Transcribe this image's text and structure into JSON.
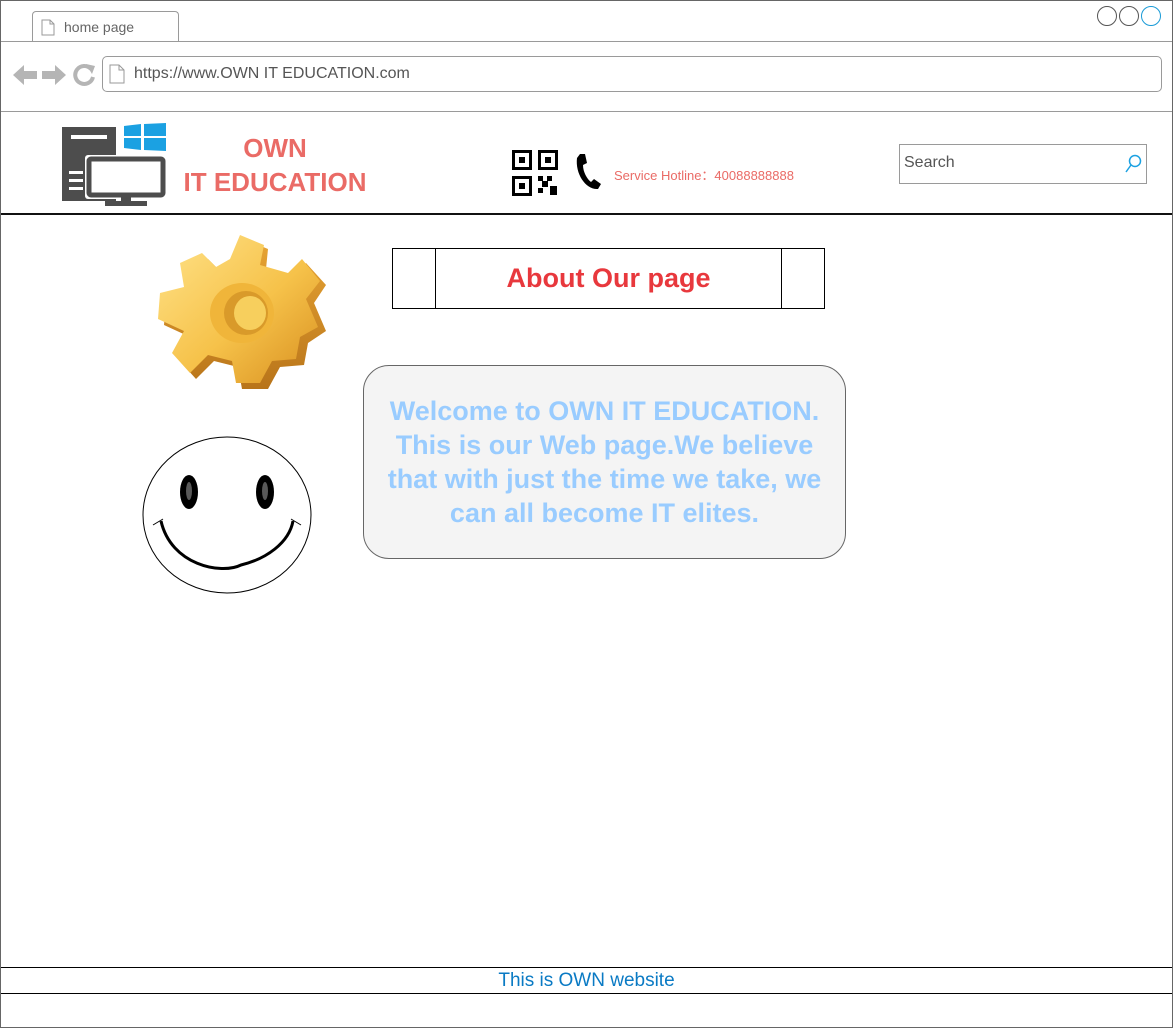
{
  "browser": {
    "tab_title": "home page",
    "url": "https://www.OWN IT EDUCATION.com"
  },
  "header": {
    "brand_line1": "OWN",
    "brand_line2": "IT EDUCATION",
    "hotline": "Service Hotline：40088888888",
    "search_placeholder": "Search"
  },
  "main": {
    "about_title": "About Our page",
    "welcome_text": "Welcome to OWN IT EDUCATION. This is our Web page.We believe that with just the time we take, we can all become IT elites."
  },
  "footer": {
    "text": "This is OWN website"
  },
  "colors": {
    "brand": "#ea6b66",
    "about_title": "#e8383d",
    "welcome_text": "#99ccff",
    "footer_text": "#0a7ac4",
    "win_accent": "#1ba1e2"
  },
  "icons": [
    "document-icon",
    "back-arrow-icon",
    "forward-arrow-icon",
    "refresh-icon",
    "computer-logo-icon",
    "windows-logo-icon",
    "qr-code-icon",
    "phone-icon",
    "search-icon",
    "gear-icon",
    "smiley-icon"
  ]
}
